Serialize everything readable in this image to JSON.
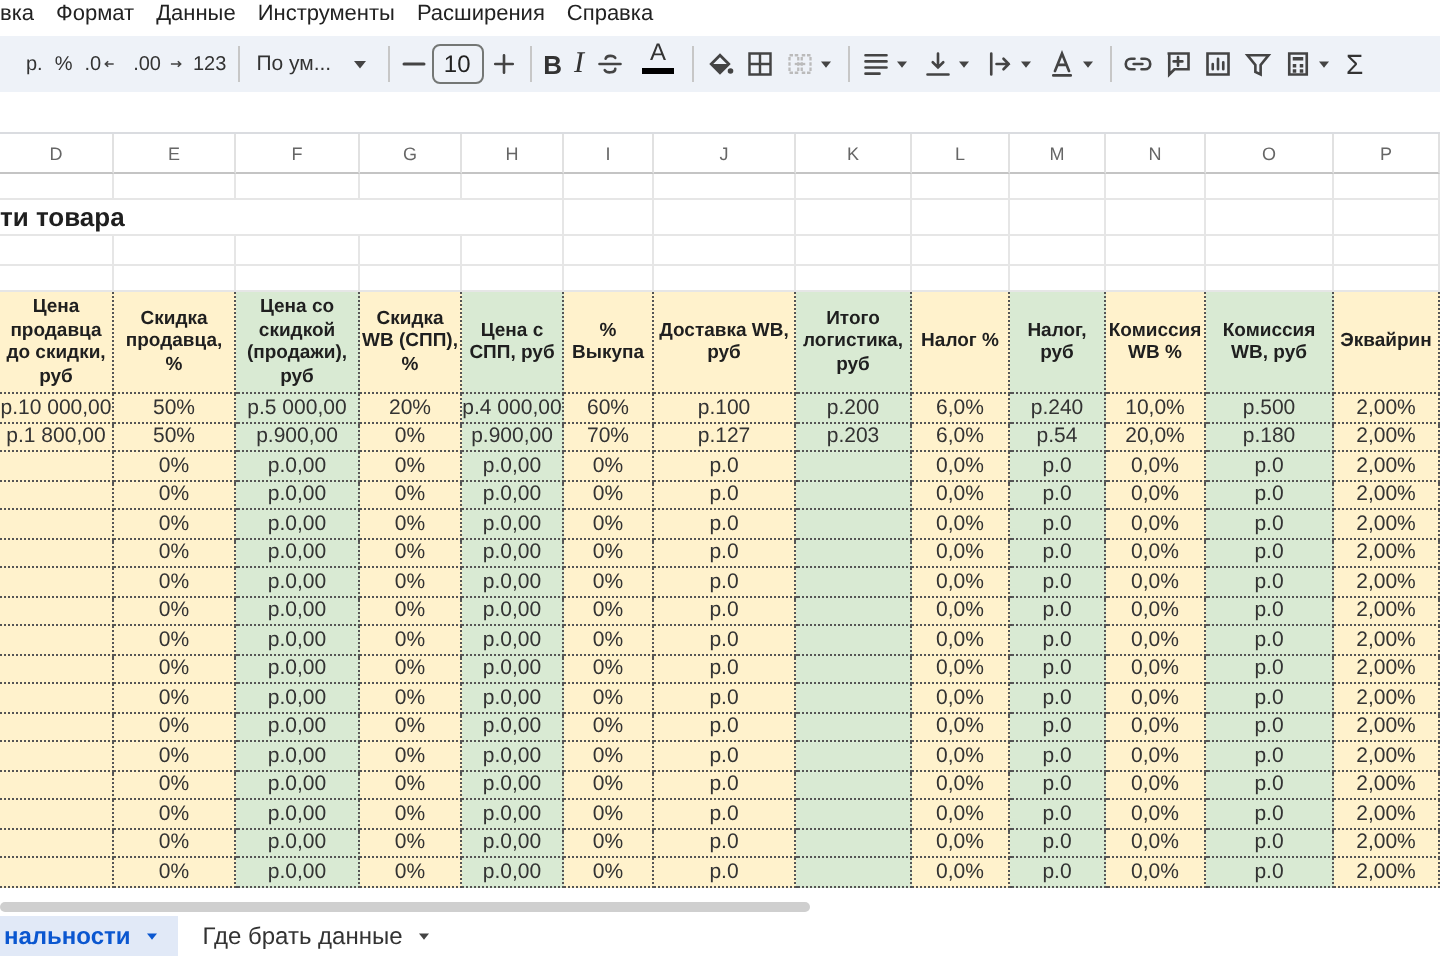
{
  "menu": [
    "вка",
    "Формат",
    "Данные",
    "Инструменты",
    "Расширения",
    "Справка"
  ],
  "toolbar": {
    "currency": "р.",
    "percent": "%",
    "decrease_decimals": ".0",
    "increase_decimals": ".00",
    "number_format": "123",
    "font": "По ум...",
    "font_size": "10",
    "bold": "B",
    "italic": "I",
    "text_color": "A",
    "sum": "Σ"
  },
  "title": "ти товара",
  "columns": [
    {
      "letter": "D",
      "header": "Цена продавца до скидки, руб",
      "color": "#fff2cc"
    },
    {
      "letter": "E",
      "header": "Скидка продавца, %",
      "color": "#fff2cc"
    },
    {
      "letter": "F",
      "header": "Цена со скидкой (продажи), руб",
      "color": "#d9ead3"
    },
    {
      "letter": "G",
      "header": "Скидка WB (СПП), %",
      "color": "#fff2cc"
    },
    {
      "letter": "H",
      "header": "Цена с СПП, руб",
      "color": "#d9ead3"
    },
    {
      "letter": "I",
      "header": "% Выкупа",
      "color": "#fff2cc"
    },
    {
      "letter": "J",
      "header": "Доставка WB, руб",
      "color": "#fff2cc"
    },
    {
      "letter": "K",
      "header": "Итого логистика, руб",
      "color": "#d9ead3"
    },
    {
      "letter": "L",
      "header": "Налог %",
      "color": "#fff2cc"
    },
    {
      "letter": "M",
      "header": "Налог, руб",
      "color": "#d9ead3"
    },
    {
      "letter": "N",
      "header": "Комиссия WB %",
      "color": "#fff2cc"
    },
    {
      "letter": "O",
      "header": "Комиссия WB, руб",
      "color": "#d9ead3"
    },
    {
      "letter": "P",
      "header": "Эквайрин",
      "color": "#fff2cc"
    }
  ],
  "rows": [
    [
      "р.10 000,00",
      "50%",
      "р.5 000,00",
      "20%",
      "р.4 000,00",
      "60%",
      "р.100",
      "р.200",
      "6,0%",
      "р.240",
      "10,0%",
      "р.500",
      "2,00%"
    ],
    [
      "р.1 800,00",
      "50%",
      "р.900,00",
      "0%",
      "р.900,00",
      "70%",
      "р.127",
      "р.203",
      "6,0%",
      "р.54",
      "20,0%",
      "р.180",
      "2,00%"
    ],
    [
      null,
      "0%",
      "р.0,00",
      "0%",
      "р.0,00",
      "0%",
      "р.0",
      null,
      "0,0%",
      "р.0",
      "0,0%",
      "р.0",
      "2,00%"
    ],
    [
      null,
      "0%",
      "р.0,00",
      "0%",
      "р.0,00",
      "0%",
      "р.0",
      null,
      "0,0%",
      "р.0",
      "0,0%",
      "р.0",
      "2,00%"
    ],
    [
      null,
      "0%",
      "р.0,00",
      "0%",
      "р.0,00",
      "0%",
      "р.0",
      null,
      "0,0%",
      "р.0",
      "0,0%",
      "р.0",
      "2,00%"
    ],
    [
      null,
      "0%",
      "р.0,00",
      "0%",
      "р.0,00",
      "0%",
      "р.0",
      null,
      "0,0%",
      "р.0",
      "0,0%",
      "р.0",
      "2,00%"
    ],
    [
      null,
      "0%",
      "р.0,00",
      "0%",
      "р.0,00",
      "0%",
      "р.0",
      null,
      "0,0%",
      "р.0",
      "0,0%",
      "р.0",
      "2,00%"
    ],
    [
      null,
      "0%",
      "р.0,00",
      "0%",
      "р.0,00",
      "0%",
      "р.0",
      null,
      "0,0%",
      "р.0",
      "0,0%",
      "р.0",
      "2,00%"
    ],
    [
      null,
      "0%",
      "р.0,00",
      "0%",
      "р.0,00",
      "0%",
      "р.0",
      null,
      "0,0%",
      "р.0",
      "0,0%",
      "р.0",
      "2,00%"
    ],
    [
      null,
      "0%",
      "р.0,00",
      "0%",
      "р.0,00",
      "0%",
      "р.0",
      null,
      "0,0%",
      "р.0",
      "0,0%",
      "р.0",
      "2,00%"
    ],
    [
      null,
      "0%",
      "р.0,00",
      "0%",
      "р.0,00",
      "0%",
      "р.0",
      null,
      "0,0%",
      "р.0",
      "0,0%",
      "р.0",
      "2,00%"
    ],
    [
      null,
      "0%",
      "р.0,00",
      "0%",
      "р.0,00",
      "0%",
      "р.0",
      null,
      "0,0%",
      "р.0",
      "0,0%",
      "р.0",
      "2,00%"
    ],
    [
      null,
      "0%",
      "р.0,00",
      "0%",
      "р.0,00",
      "0%",
      "р.0",
      null,
      "0,0%",
      "р.0",
      "0,0%",
      "р.0",
      "2,00%"
    ],
    [
      null,
      "0%",
      "р.0,00",
      "0%",
      "р.0,00",
      "0%",
      "р.0",
      null,
      "0,0%",
      "р.0",
      "0,0%",
      "р.0",
      "2,00%"
    ],
    [
      null,
      "0%",
      "р.0,00",
      "0%",
      "р.0,00",
      "0%",
      "р.0",
      null,
      "0,0%",
      "р.0",
      "0,0%",
      "р.0",
      "2,00%"
    ],
    [
      null,
      "0%",
      "р.0,00",
      "0%",
      "р.0,00",
      "0%",
      "р.0",
      null,
      "0,0%",
      "р.0",
      "0,0%",
      "р.0",
      "2,00%"
    ],
    [
      null,
      "0%",
      "р.0,00",
      "0%",
      "р.0,00",
      "0%",
      "р.0",
      null,
      "0,0%",
      "р.0",
      "0,0%",
      "р.0",
      "2,00%"
    ]
  ],
  "sheet_tabs": [
    {
      "label": "нальности",
      "selected": true
    },
    {
      "label": "Где брать данные",
      "selected": false
    }
  ]
}
